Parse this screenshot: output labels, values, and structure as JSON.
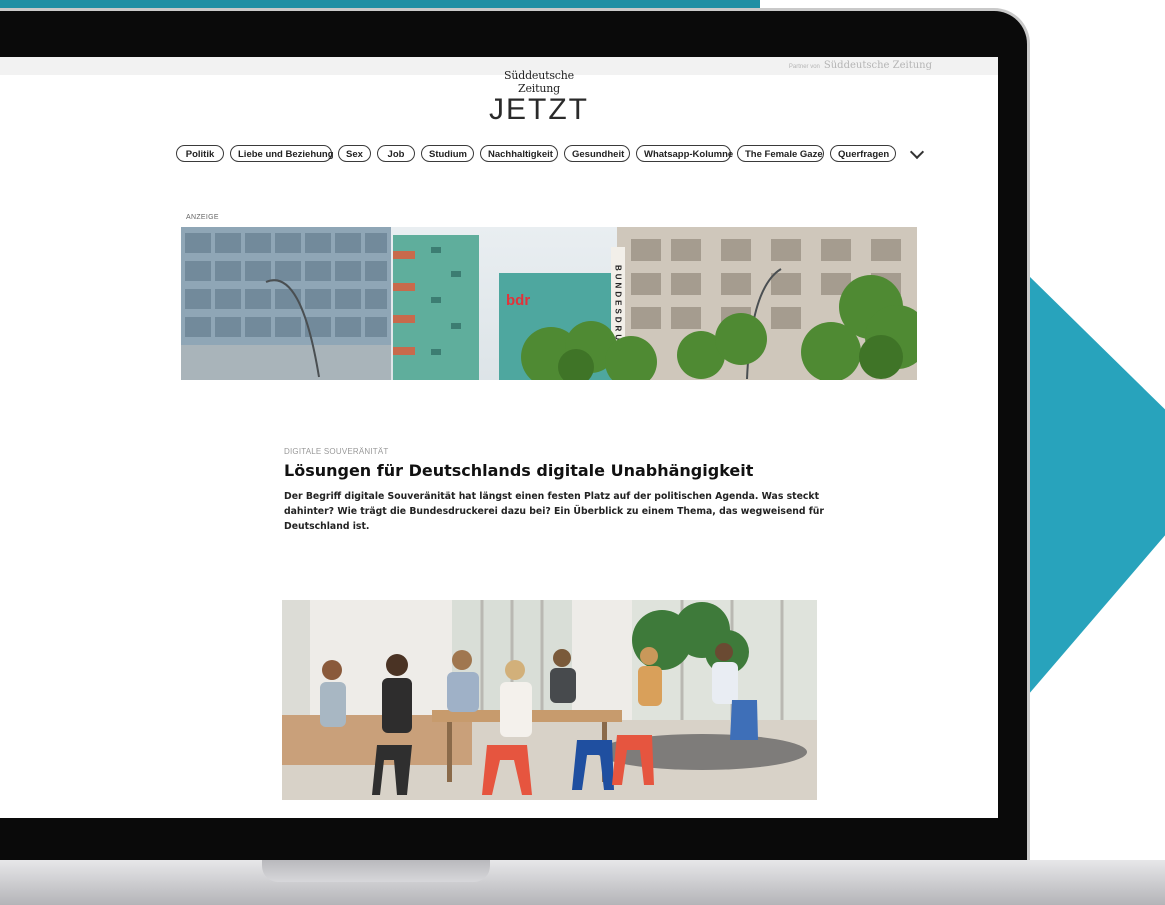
{
  "partner_bar": {
    "prefix": "Partner von",
    "brand": "Süddeutsche Zeitung"
  },
  "logo": {
    "top": "Süddeutsche Zeitung",
    "main": "JETZT"
  },
  "nav": {
    "items": [
      "Politik",
      "Liebe und Beziehung",
      "Sex",
      "Job",
      "Studium",
      "Nachhaltigkeit",
      "Gesundheit",
      "Whatsapp-Kolumne",
      "The Female Gaze",
      "Querfragen"
    ],
    "more_icon": "chevron-down-icon"
  },
  "ad": {
    "label": "ANZEIGE",
    "building_sign": "bdr",
    "vertical_sign": "BUNDESDRU"
  },
  "article": {
    "kicker": "DIGITALE SOUVERÄNITÄT",
    "headline": "Lösungen für Deutschlands digitale Unabhängigkeit",
    "teaser": "Der Begriff digitale Souveränität hat längst einen festen Platz auf der politischen Agenda. Was steckt dahinter? Wie trägt die Bundesdruckerei dazu bei? Ein Überblick zu einem Thema, das wegweisend für Deutschland ist."
  },
  "colors": {
    "teal": "#28a3bc",
    "laptop_frame": "#0a0a0a"
  }
}
